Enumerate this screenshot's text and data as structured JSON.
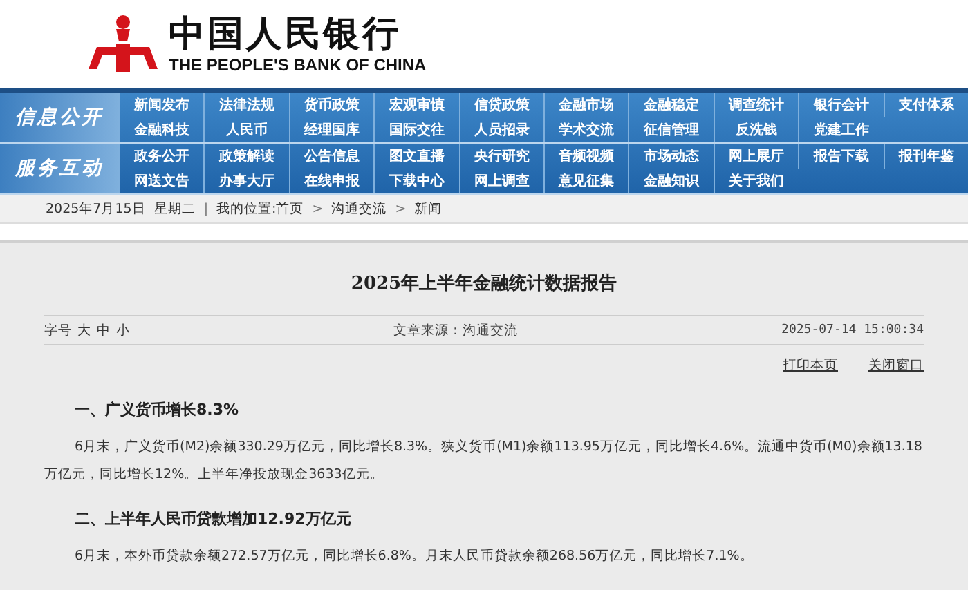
{
  "header": {
    "name_zh": "中国人民银行",
    "name_en": "THE PEOPLE'S BANK OF CHINA"
  },
  "nav": [
    {
      "label": "信息公开",
      "rows": [
        [
          "新闻发布",
          "法律法规",
          "货币政策",
          "宏观审慎",
          "信贷政策",
          "金融市场",
          "金融稳定",
          "调查统计",
          "银行会计",
          "支付体系"
        ],
        [
          "金融科技",
          "人民币",
          "经理国库",
          "国际交往",
          "人员招录",
          "学术交流",
          "征信管理",
          "反洗钱",
          "党建工作"
        ]
      ]
    },
    {
      "label": "服务互动",
      "rows": [
        [
          "政务公开",
          "政策解读",
          "公告信息",
          "图文直播",
          "央行研究",
          "音频视频",
          "市场动态",
          "网上展厅",
          "报告下载",
          "报刊年鉴"
        ],
        [
          "网送文告",
          "办事大厅",
          "在线申报",
          "下载中心",
          "网上调查",
          "意见征集",
          "金融知识",
          "关于我们"
        ]
      ]
    }
  ],
  "breadcrumb": {
    "date": "2025年7月15日",
    "weekday": "星期二",
    "divider": "|",
    "path_separator": ">",
    "location": "我的位置:首页",
    "path": [
      "沟通交流",
      "新闻"
    ]
  },
  "article": {
    "title": "2025年上半年金融统计数据报告",
    "font_size_label": "字号",
    "font_sizes": [
      "大",
      "中",
      "小"
    ],
    "source": "文章来源：沟通交流",
    "datetime": "2025-07-14 15:00:34",
    "actions": [
      "打印本页",
      "关闭窗口"
    ],
    "sections": [
      {
        "heading": "一、广义货币增长8.3%",
        "paragraph": "6月末，广义货币(M2)余额330.29万亿元，同比增长8.3%。狭义货币(M1)余额113.95万亿元，同比增长4.6%。流通中货币(M0)余额13.18万亿元，同比增长12%。上半年净投放现金3633亿元。"
      },
      {
        "heading": "二、上半年人民币贷款增加12.92万亿元",
        "paragraph": "6月末，本外币贷款余额272.57万亿元，同比增长6.8%。月末人民币贷款余额268.56万亿元，同比增长7.1%。"
      }
    ]
  }
}
